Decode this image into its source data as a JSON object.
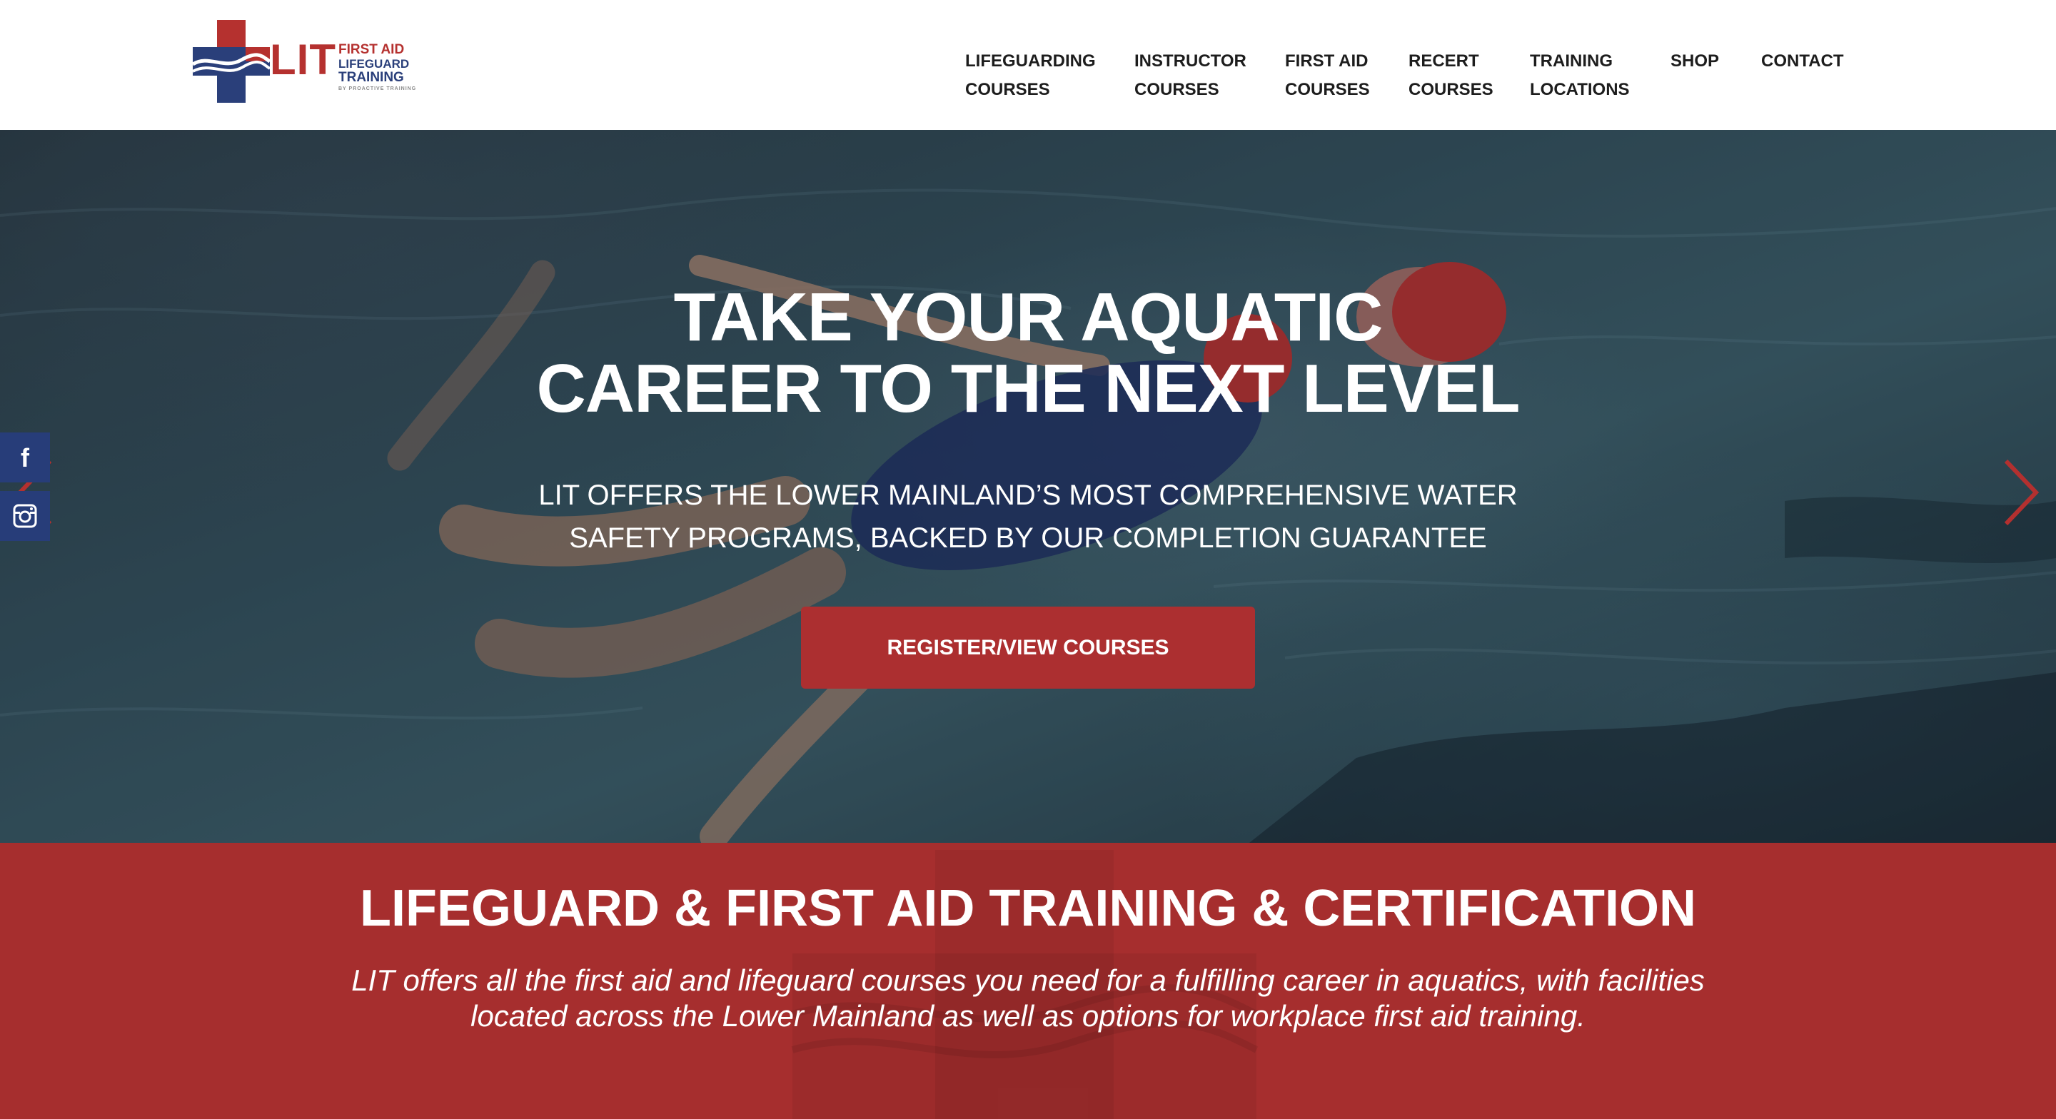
{
  "header": {
    "logo": {
      "lit": "LIT",
      "line1": "FIRST AID",
      "line2": "LIFEGUARD",
      "line3": "TRAINING",
      "line4": "BY PROACTIVE TRAINING"
    },
    "nav": [
      {
        "line1": "LIFEGUARDING",
        "line2": "COURSES"
      },
      {
        "line1": "INSTRUCTOR",
        "line2": "COURSES"
      },
      {
        "line1": "FIRST AID",
        "line2": "COURSES"
      },
      {
        "line1": "RECERT",
        "line2": "COURSES"
      },
      {
        "line1": "TRAINING",
        "line2": "LOCATIONS"
      },
      {
        "line1": "SHOP",
        "line2": ""
      },
      {
        "line1": "CONTACT",
        "line2": ""
      }
    ]
  },
  "hero": {
    "title_line1": "TAKE YOUR AQUATIC",
    "title_line2": "CAREER TO THE NEXT LEVEL",
    "sub_line1": "LIT OFFERS THE LOWER MAINLAND’S MOST COMPREHENSIVE WATER",
    "sub_line2": "SAFETY PROGRAMS, BACKED BY OUR COMPLETION GUARANTEE",
    "cta_label": "REGISTER/VIEW COURSES",
    "prev_icon": "chevron-left-icon",
    "next_icon": "chevron-right-icon"
  },
  "social": [
    {
      "icon": "facebook-icon",
      "glyph": "f"
    },
    {
      "icon": "instagram-icon"
    }
  ],
  "band": {
    "title": "LIFEGUARD & FIRST AID TRAINING & CERTIFICATION",
    "text_line1": "LIT offers all the first aid and lifeguard courses you need for a fulfilling career in aquatics, with facilities",
    "text_line2": "located across the Lower Mainland as well as options for workplace first aid training."
  },
  "colors": {
    "brand_red": "#ac2f30",
    "brand_navy": "#273d79",
    "band_red": "#a62e2e"
  }
}
